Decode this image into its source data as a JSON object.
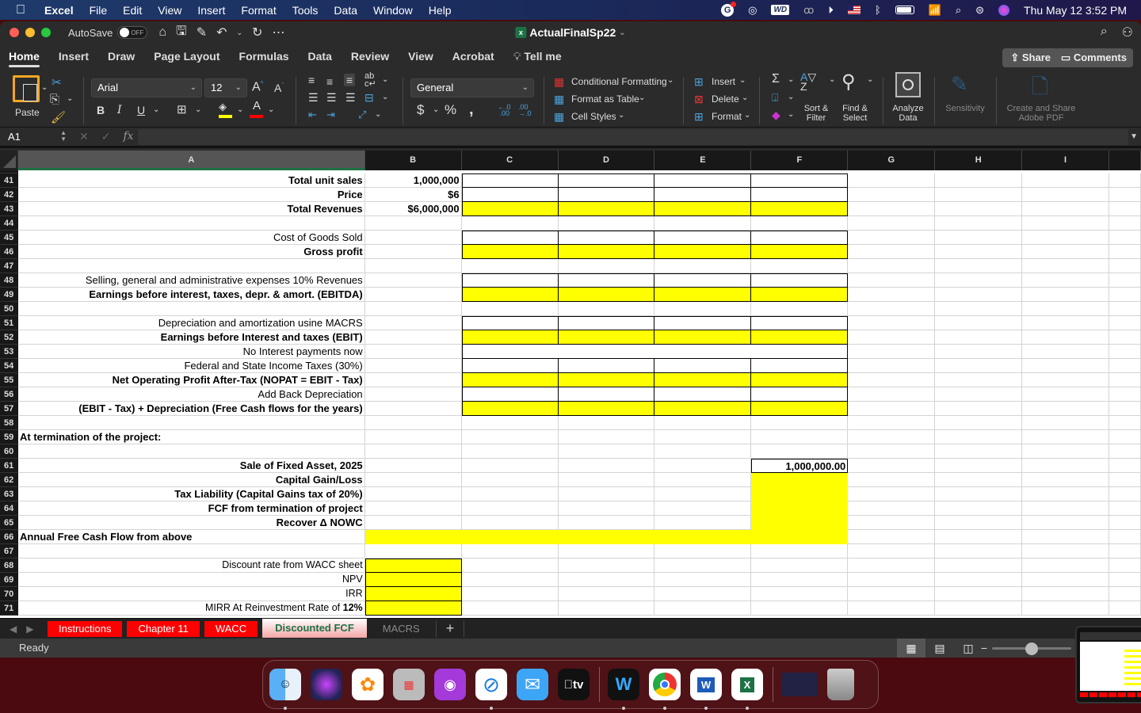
{
  "menubar": {
    "app_name": "Excel",
    "items": [
      "File",
      "Edit",
      "View",
      "Insert",
      "Format",
      "Tools",
      "Data",
      "Window",
      "Help"
    ],
    "status_icons": [
      "grammarly-icon",
      "creative-cloud-icon",
      "wd-icon",
      "webex-icon",
      "play-icon",
      "us-flag-icon",
      "bluetooth-icon",
      "battery-icon",
      "wifi-icon",
      "spotlight-icon",
      "control-center-icon",
      "siri-icon"
    ],
    "wd_label": "WD",
    "clock": "Thu May 12  3:52 PM"
  },
  "window": {
    "autosave_label": "AutoSave",
    "autosave_state": "OFF",
    "doc_title": "ActualFinalSp22",
    "ribbon_tabs": [
      "Home",
      "Insert",
      "Draw",
      "Page Layout",
      "Formulas",
      "Data",
      "Review",
      "View",
      "Acrobat"
    ],
    "tell_me": "Tell me",
    "share_label": "Share",
    "comments_label": "Comments"
  },
  "ribbon": {
    "paste_label": "Paste",
    "font_name": "Arial",
    "font_size": "12",
    "bold": "B",
    "italic": "I",
    "underline": "U",
    "number_format": "General",
    "currency": "$",
    "percent": "%",
    "comma": ",",
    "conditional_formatting": "Conditional Formatting",
    "format_as_table": "Format as Table",
    "cell_styles": "Cell Styles",
    "insert": "Insert",
    "delete": "Delete",
    "format": "Format",
    "sort_filter": "Sort & Filter",
    "find_select": "Find & Select",
    "analyze_data": "Analyze Data",
    "sensitivity": "Sensitivity",
    "adobe_pdf": "Create and Share Adobe PDF",
    "colors": {
      "fill": "#ffff00",
      "font": "#ff0000"
    }
  },
  "formula_bar": {
    "name_box": "A1",
    "formula": ""
  },
  "sheet": {
    "columns": [
      "A",
      "B",
      "C",
      "D",
      "E",
      "F",
      "G",
      "H",
      "I"
    ],
    "selected_column": "A",
    "rows": [
      {
        "n": "41",
        "a": "Total unit sales",
        "a_bold": true,
        "b": "1,000,000",
        "cf": "box"
      },
      {
        "n": "42",
        "a": "Price",
        "a_bold": true,
        "b": "$6",
        "cf": "box"
      },
      {
        "n": "43",
        "a": "Total Revenues",
        "a_bold": true,
        "b": "$6,000,000",
        "cf": "yellow"
      },
      {
        "n": "44",
        "a": "",
        "b": "",
        "cf": ""
      },
      {
        "n": "45",
        "a": "Cost of Goods Sold",
        "a_bold": false,
        "b": "",
        "cf": "box"
      },
      {
        "n": "46",
        "a": "Gross profit",
        "a_bold": true,
        "b": "",
        "cf": "yellow"
      },
      {
        "n": "47",
        "a": "",
        "b": "",
        "cf": ""
      },
      {
        "n": "48",
        "a": "Selling, general and administrative expenses 10% Revenues",
        "a_bold": false,
        "b": "",
        "cf": "box"
      },
      {
        "n": "49",
        "a": "Earnings before interest, taxes, depr. & amort. (EBITDA)",
        "a_bold": true,
        "b": "",
        "cf": "yellow"
      },
      {
        "n": "50",
        "a": "",
        "b": "",
        "cf": ""
      },
      {
        "n": "51",
        "a": "Depreciation and amortization usine MACRS",
        "a_bold": false,
        "b": "",
        "cf": "box"
      },
      {
        "n": "52",
        "a": "Earnings before Interest and taxes (EBIT)",
        "a_bold": true,
        "b": "",
        "cf": "yellow"
      },
      {
        "n": "53",
        "a": "No Interest payments now",
        "a_bold": false,
        "b": "",
        "cf": "open"
      },
      {
        "n": "54",
        "a": "Federal and State Income Taxes (30%)",
        "a_bold": false,
        "b": "",
        "cf": "box"
      },
      {
        "n": "55",
        "a": "Net Operating Profit After-Tax (NOPAT = EBIT - Tax)",
        "a_bold": true,
        "b": "",
        "cf": "yellow"
      },
      {
        "n": "56",
        "a": "Add Back Depreciation",
        "a_bold": false,
        "b": "",
        "cf": "box"
      },
      {
        "n": "57",
        "a": "(EBIT - Tax) + Depreciation (Free Cash flows for the years)",
        "a_bold": true,
        "b": "",
        "cf": "yellow"
      },
      {
        "n": "58",
        "a": "",
        "b": "",
        "cf": ""
      },
      {
        "n": "59",
        "a": "At termination of the project:",
        "a_bold": true,
        "a_left": true,
        "b": "",
        "cf": ""
      },
      {
        "n": "60",
        "a": "",
        "b": "",
        "cf": ""
      },
      {
        "n": "61",
        "a": "Sale of Fixed Asset, 2025",
        "a_bold": true,
        "b": "",
        "cf": "f-box",
        "f": "1,000,000.00"
      },
      {
        "n": "62",
        "a": "Capital Gain/Loss",
        "a_bold": true,
        "b": "",
        "cf": "f-yellow"
      },
      {
        "n": "63",
        "a": "Tax Liability (Capital Gains tax of 20%)",
        "a_bold": true,
        "b": "",
        "cf": "f-yellow"
      },
      {
        "n": "64",
        "a": "FCF from termination of project",
        "a_bold": true,
        "b": "",
        "cf": "f-yellow"
      },
      {
        "n": "65",
        "a": "Recover Δ NOWC",
        "a_bold": true,
        "b": "",
        "cf": "f-yellow"
      },
      {
        "n": "66",
        "a": "Annual Free Cash Flow from above",
        "a_bold": true,
        "a_left": true,
        "b": "",
        "cf": "bf-yellow"
      },
      {
        "n": "67",
        "a": "",
        "b": "",
        "cf": ""
      },
      {
        "n": "68",
        "a": "Discount rate from WACC sheet",
        "a_bold": false,
        "a_cal": true,
        "b_yellow": true,
        "cf": ""
      },
      {
        "n": "69",
        "a": "NPV",
        "a_bold": false,
        "a_cal": true,
        "b_yellow": true,
        "cf": ""
      },
      {
        "n": "70",
        "a": "IRR",
        "a_bold": false,
        "a_cal": true,
        "b_yellow": true,
        "cf": ""
      },
      {
        "n": "71",
        "a": "MIRR At Reinvestment Rate of ",
        "a_suffix_bold": "12%",
        "a_bold": false,
        "a_cal": true,
        "b_yellow": true,
        "cf": ""
      }
    ],
    "tabs": [
      {
        "label": "Instructions",
        "style": "red"
      },
      {
        "label": "Chapter 11",
        "style": "red"
      },
      {
        "label": "WACC",
        "style": "red"
      },
      {
        "label": "Discounted FCF",
        "style": "active"
      },
      {
        "label": "MACRS",
        "style": "plain"
      }
    ],
    "add_sheet": "+"
  },
  "status": {
    "text": "Ready",
    "zoom_fraction": 0.5
  },
  "dock": {
    "apps": [
      "Finder",
      "Siri",
      "Photos",
      "Launchpad",
      "Podcasts",
      "Safari",
      "Mail",
      "TV",
      "Webex",
      "Chrome",
      "Word",
      "Excel",
      "Safari Window",
      "Trash"
    ],
    "tv_label": "tv",
    "word_label": "W",
    "excel_label": "X"
  }
}
